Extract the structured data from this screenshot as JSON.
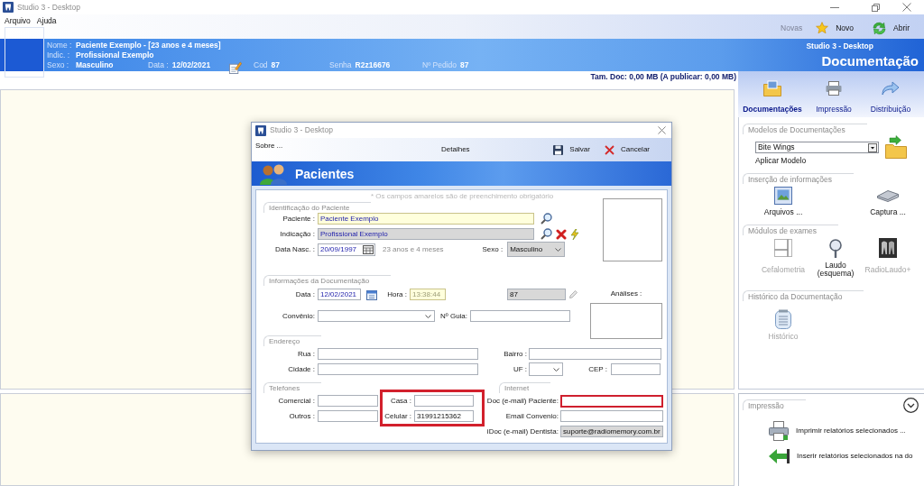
{
  "window": {
    "title": "Studio 3 - Desktop"
  },
  "menu": [
    "Arquivo",
    "Ajuda"
  ],
  "toolbar": {
    "caption": "Novas",
    "buttons": [
      {
        "label": "Novo",
        "kind": "new"
      },
      {
        "label": "Abrir",
        "kind": "open"
      }
    ]
  },
  "patient_header": {
    "fields": [
      {
        "label": "Nome :",
        "value": "Paciente Exemplo - [23 anos e 4 meses]"
      },
      {
        "label": "Indic. :",
        "value": "Profissional Exemplo"
      },
      {
        "label": "Sexo :",
        "value": "Masculino"
      }
    ],
    "details": [
      {
        "label": "Data :",
        "value": "12/02/2021"
      },
      {
        "label": "Cod",
        "value": "87"
      },
      {
        "label": "Senha",
        "value": "R2z16676"
      },
      {
        "label": "Nº Pedido",
        "value": "87"
      }
    ],
    "app_name": "Studio 3 - Desktop",
    "module": "Documentação"
  },
  "doc_size": "Tam. Doc: 0,00 MB (A publicar: 0,00 MB)",
  "side_panel": {
    "tabs": [
      {
        "label": "Documentações",
        "kind": "docs",
        "selected": true
      },
      {
        "label": "Impressão",
        "kind": "print",
        "selected": false
      },
      {
        "label": "Distribuição",
        "kind": "share",
        "selected": false
      }
    ],
    "model_group": {
      "title": "Modelos de Documentações",
      "select": "Bite Wings",
      "action": "Aplicar Modelo"
    },
    "groups": [
      {
        "title": "Inserção de informações",
        "items": [
          {
            "label": "Arquivos ...",
            "kind": "files",
            "disabled": false
          },
          {
            "label": "Captura ...",
            "kind": "capture",
            "disabled": false
          }
        ]
      },
      {
        "title": "Módulos de exames",
        "items": [
          {
            "label": "Cefalometria",
            "kind": "ceph",
            "disabled": true
          },
          {
            "label": "Laudo (esquema)",
            "kind": "report",
            "disabled": false
          },
          {
            "label": "RadioLaudo+",
            "kind": "xray",
            "disabled": true
          }
        ]
      },
      {
        "title": "Histórico da Documentação",
        "items": [
          {
            "label": "Histórico",
            "kind": "history",
            "disabled": true
          }
        ]
      }
    ]
  },
  "print_panel": {
    "title": "Impressão",
    "items": [
      {
        "label": "Imprimir relatórios selecionados ...",
        "kind": "print"
      },
      {
        "label": "Inserir relatórios selecionados na do",
        "kind": "insert"
      }
    ]
  },
  "dialog": {
    "title": "Studio 3 - Desktop",
    "menu": [
      "Sobre ..."
    ],
    "caption": "Detalhes",
    "actions": [
      {
        "label": "Salvar",
        "kind": "save"
      },
      {
        "label": "Cancelar",
        "kind": "cancel"
      }
    ],
    "heading": "Pacientes",
    "note": "* Os campos amarelos são de preenchimento obrigatório",
    "identification": {
      "title": "Identificação do Paciente",
      "age": "23 anos e 4 meses",
      "fields": [
        {
          "label": "Paciente :",
          "value": "Paciente Exemplo",
          "kind": "text",
          "required": true,
          "readonly": false
        },
        {
          "label": "Indicação :",
          "value": "Profissional Exemplo",
          "kind": "text",
          "required": false,
          "readonly": true
        },
        {
          "label": "Data Nasc. :",
          "value": "20/09/1997",
          "kind": "date",
          "required": false,
          "readonly": false
        },
        {
          "label": "Sexo :",
          "value": "Masculino",
          "kind": "select",
          "required": false,
          "readonly": true
        }
      ]
    },
    "documentation": {
      "title": "Informações da Documentação",
      "analyses_label": "Análises :",
      "fields": [
        {
          "label": "Data :",
          "value": "12/02/2021",
          "kind": "text",
          "required": false,
          "readonly": false
        },
        {
          "label": "Hora :",
          "value": "13:38:44",
          "kind": "text",
          "required": true,
          "readonly": false
        },
        {
          "value": "87",
          "kind": "text",
          "required": false,
          "readonly": true
        },
        {
          "label": "Convênio:",
          "kind": "select",
          "required": false,
          "readonly": false
        },
        {
          "label": "Nº Guia:",
          "kind": "text",
          "required": false,
          "readonly": false
        }
      ]
    },
    "address": {
      "title": "Endereço",
      "fields": [
        {
          "label": "Rua :",
          "kind": "text",
          "required": false,
          "readonly": false
        },
        {
          "label": "Bairro :",
          "kind": "text",
          "required": false,
          "readonly": false
        },
        {
          "label": "Cidade :",
          "kind": "text",
          "required": false,
          "readonly": false
        },
        {
          "label": "UF :",
          "kind": "select",
          "required": false,
          "readonly": false
        },
        {
          "label": "CEP :",
          "kind": "text",
          "required": false,
          "readonly": false
        }
      ]
    },
    "phones": {
      "title": "Telefones",
      "fields": [
        {
          "label": "Comercial :",
          "kind": "text",
          "required": false,
          "readonly": false
        },
        {
          "label": "Outros :",
          "kind": "text",
          "required": false,
          "readonly": false
        }
      ],
      "home_mobile": {
        "highlighted": true,
        "fields": [
          {
            "label": "Casa :",
            "kind": "text",
            "required": false,
            "readonly": false
          },
          {
            "label": "Celular :",
            "value": "31991215362",
            "kind": "text",
            "required": false,
            "readonly": false
          }
        ]
      }
    },
    "internet": {
      "title": "Internet",
      "fields": [
        {
          "label": "Doc (e-mail) Paciente:",
          "kind": "text",
          "required": false,
          "readonly": false,
          "highlighted": true
        },
        {
          "label": "Email Convenio:",
          "kind": "text",
          "required": false,
          "readonly": false,
          "highlighted": false
        },
        {
          "label": "iDoc (e-mail) Dentista:",
          "value": "suporte@radiomemory.com.br",
          "kind": "text",
          "required": false,
          "readonly": true,
          "highlighted": false
        }
      ]
    }
  }
}
